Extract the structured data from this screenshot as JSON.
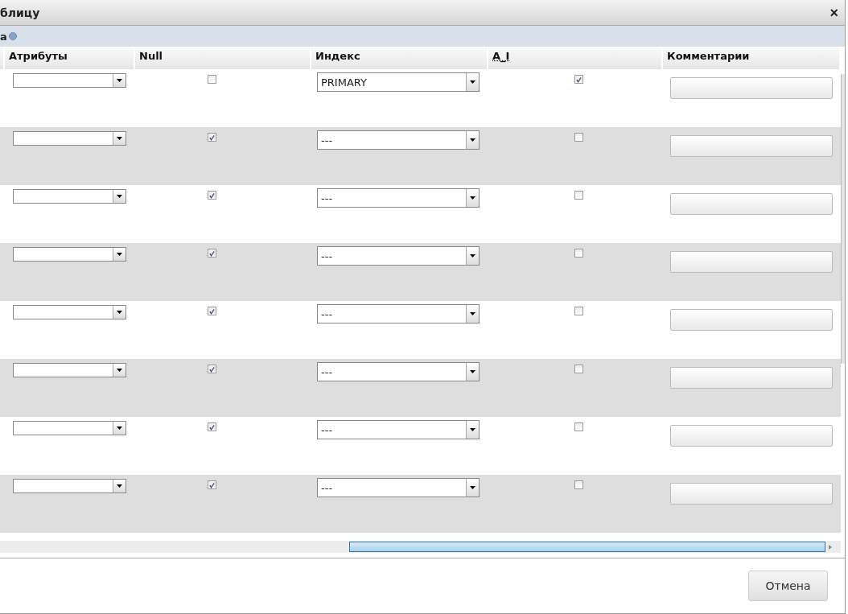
{
  "window": {
    "title": "блицу",
    "close": "×"
  },
  "section": {
    "label": "а"
  },
  "table": {
    "columns": [
      "Атрибуты",
      "Null",
      "Индекс",
      "A_I",
      "Комментарии"
    ],
    "rows": [
      {
        "null": false,
        "index": "PRIMARY",
        "ai": true
      },
      {
        "null": true,
        "index": "---",
        "ai": false
      },
      {
        "null": true,
        "index": "---",
        "ai": false
      },
      {
        "null": true,
        "index": "---",
        "ai": false
      },
      {
        "null": true,
        "index": "---",
        "ai": false
      },
      {
        "null": true,
        "index": "---",
        "ai": false
      },
      {
        "null": true,
        "index": "---",
        "ai": false
      },
      {
        "null": true,
        "index": "---",
        "ai": false
      }
    ]
  },
  "buttons": [
    "Отмена"
  ]
}
